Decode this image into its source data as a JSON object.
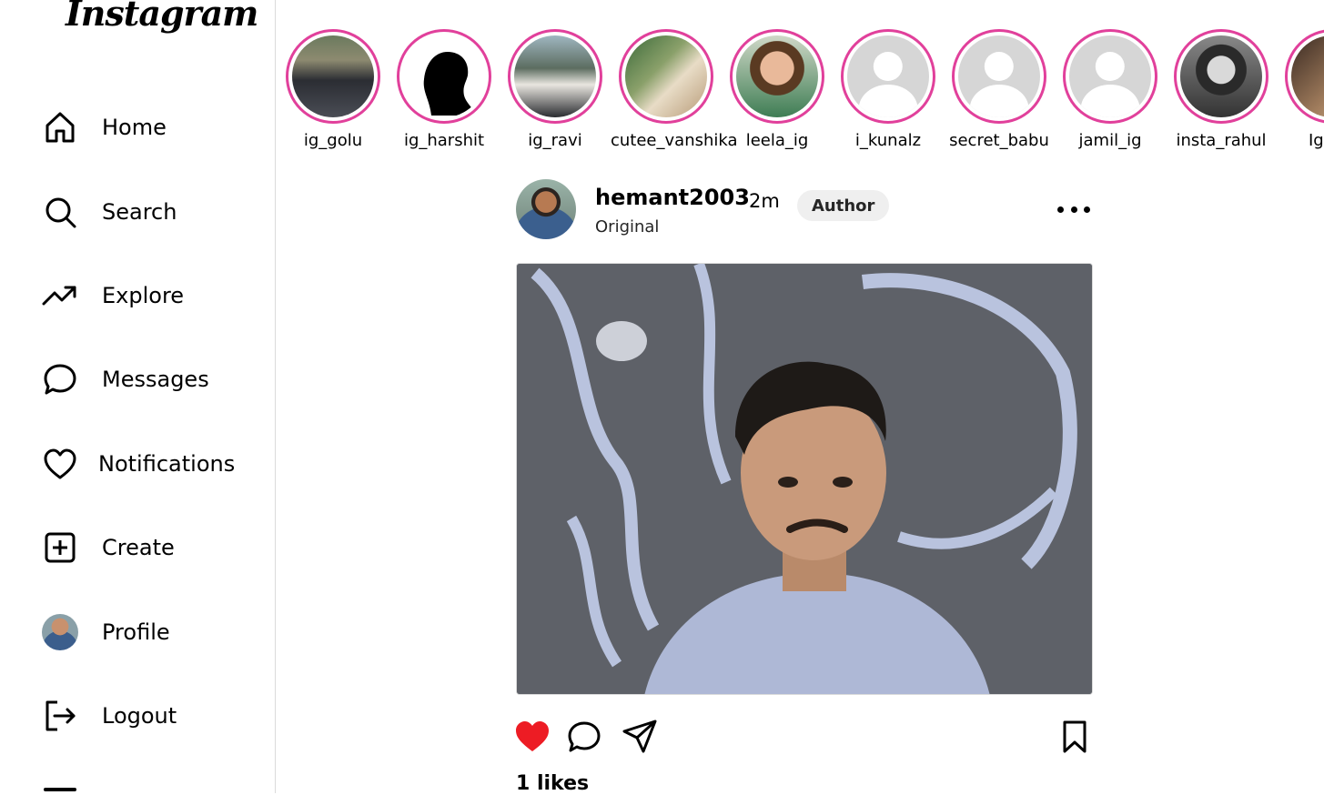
{
  "app": {
    "logo_text": "Instagram"
  },
  "sidebar": {
    "items": [
      {
        "label": "Home",
        "icon": "home-icon"
      },
      {
        "label": "Search",
        "icon": "search-icon"
      },
      {
        "label": "Explore",
        "icon": "trending-icon"
      },
      {
        "label": "Messages",
        "icon": "message-icon"
      },
      {
        "label": "Notifications",
        "icon": "heart-icon"
      },
      {
        "label": "Create",
        "icon": "plus-square-icon"
      },
      {
        "label": "Profile",
        "icon": "avatar"
      },
      {
        "label": "Logout",
        "icon": "logout-icon"
      }
    ]
  },
  "stories": [
    {
      "username": "ig_golu"
    },
    {
      "username": "ig_harshit"
    },
    {
      "username": "ig_ravi"
    },
    {
      "username": "cutee_vanshika"
    },
    {
      "username": "leela_ig"
    },
    {
      "username": "i_kunalz"
    },
    {
      "username": "secret_babu"
    },
    {
      "username": "jamil_ig"
    },
    {
      "username": "insta_rahul"
    },
    {
      "username": "Ig"
    }
  ],
  "post": {
    "username": "hemant2003",
    "time": "2m",
    "badge": "Author",
    "subtitle": "Original",
    "liked": true,
    "likes_text": "1 likes"
  },
  "colors": {
    "story_ring": "#e1409b",
    "like_red": "#ed1c24",
    "border": "#dbdbdb"
  }
}
